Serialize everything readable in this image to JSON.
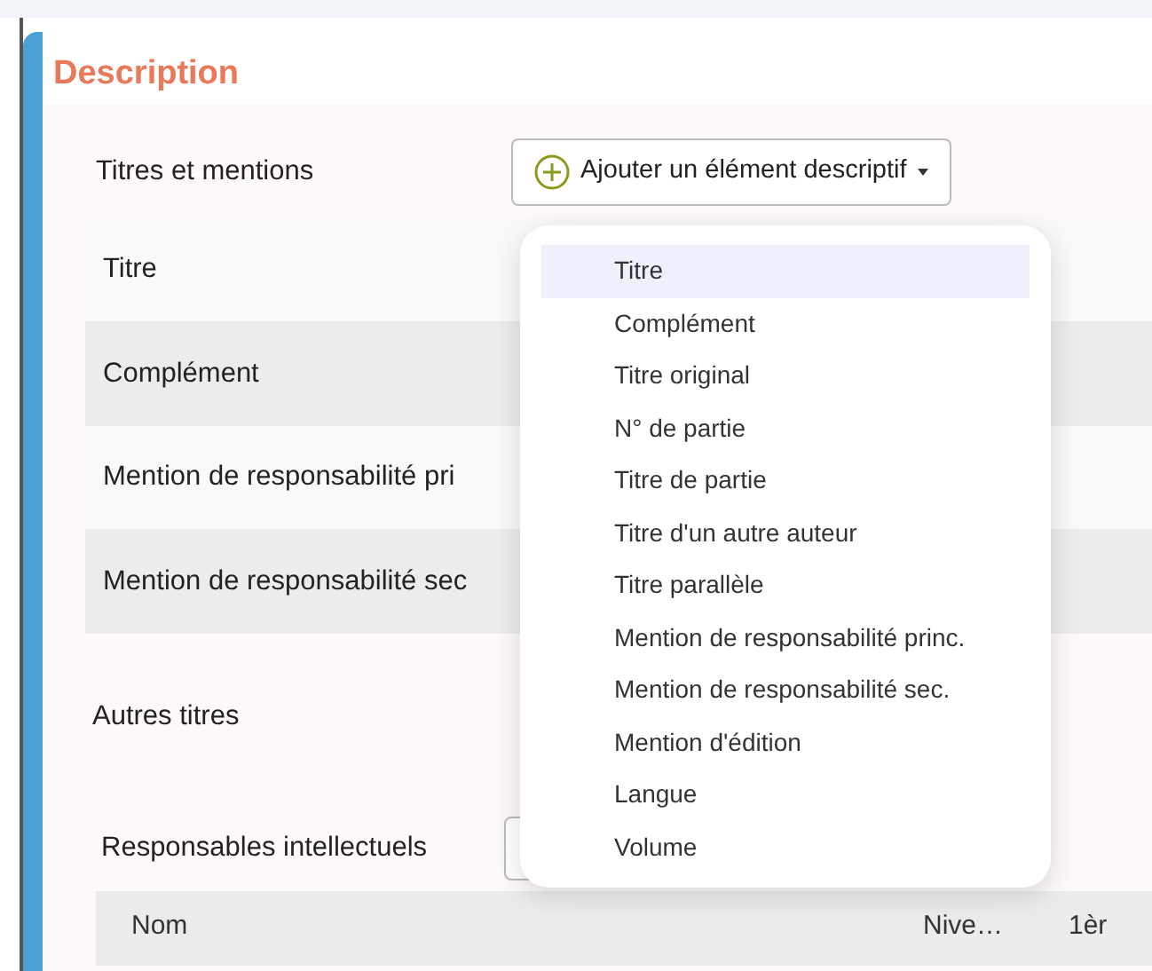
{
  "section": {
    "title": "Description"
  },
  "titles": {
    "label": "Titres et mentions",
    "add_button": "Ajouter un élément descriptif",
    "rows": [
      {
        "label": "Titre"
      },
      {
        "label": "Complément"
      },
      {
        "label": "Mention de responsabilité pri"
      },
      {
        "label": "Mention de responsabilité sec"
      }
    ]
  },
  "dropdown": {
    "items": [
      {
        "label": "Titre",
        "selected": true
      },
      {
        "label": "Complément",
        "selected": false
      },
      {
        "label": "Titre original",
        "selected": false
      },
      {
        "label": "N° de partie",
        "selected": false
      },
      {
        "label": "Titre de partie",
        "selected": false
      },
      {
        "label": "Titre d'un autre auteur",
        "selected": false
      },
      {
        "label": "Titre parallèle",
        "selected": false
      },
      {
        "label": "Mention de responsabilité princ.",
        "selected": false
      },
      {
        "label": "Mention de responsabilité sec.",
        "selected": false
      },
      {
        "label": "Mention d'édition",
        "selected": false
      },
      {
        "label": "Langue",
        "selected": false
      },
      {
        "label": "Volume",
        "selected": false
      }
    ]
  },
  "other_titles": {
    "label": "Autres titres"
  },
  "responsables": {
    "label": "Responsables intellectuels",
    "table": {
      "columns": [
        "Nom",
        "Nive…",
        "1èr"
      ]
    }
  }
}
